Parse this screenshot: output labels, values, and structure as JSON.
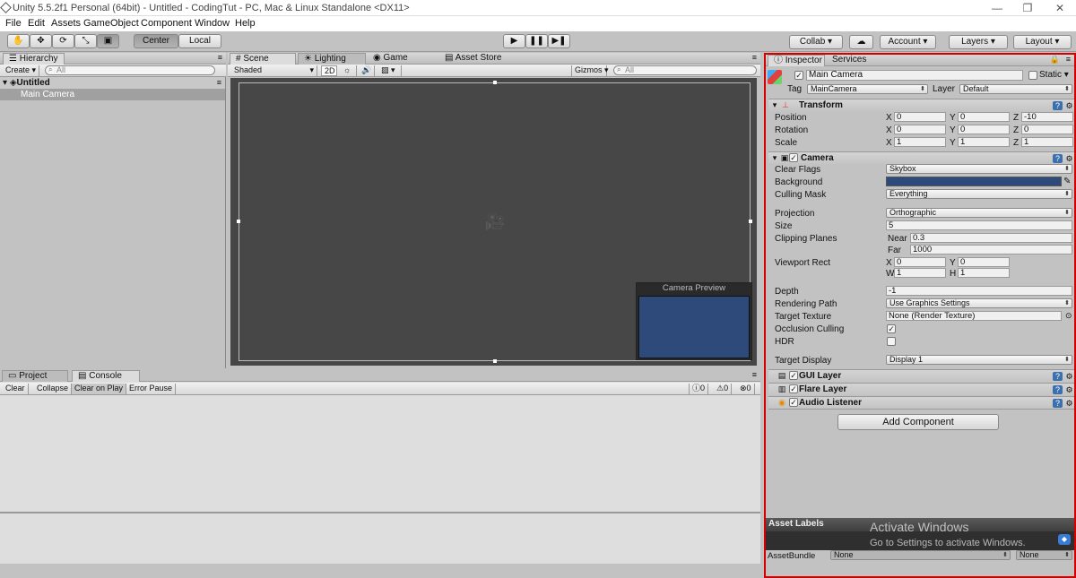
{
  "window": {
    "title": "Unity 5.5.2f1 Personal (64bit) - Untitled - CodingTut - PC, Mac & Linux Standalone <DX11>",
    "min_icon": "minimize-icon",
    "max_icon": "maximize-icon",
    "close_icon": "close-icon"
  },
  "menu": [
    "File",
    "Edit",
    "Assets",
    "GameObject",
    "Component",
    "Window",
    "Help"
  ],
  "toolbar": {
    "tools": [
      "hand-icon",
      "move-icon",
      "rotate-icon",
      "scale-icon",
      "rect-icon"
    ],
    "pivot": "Center",
    "space": "Local",
    "collab": "Collab",
    "cloud_icon": "cloud-icon",
    "account": "Account",
    "layers": "Layers",
    "layout": "Layout"
  },
  "hierarchy": {
    "tab": "Hierarchy",
    "create": "Create",
    "search_placeholder": "All",
    "scene": "Untitled",
    "items": [
      "Main Camera"
    ]
  },
  "scene": {
    "tabs": [
      "Scene",
      "Lighting",
      "Game",
      "Asset Store"
    ],
    "shading": "Shaded",
    "mode2d": "2D",
    "gizmos": "Gizmos",
    "search_placeholder": "All",
    "camera_preview": "Camera Preview",
    "colors": {
      "viewport": "#474747",
      "preview": "#2d4a7a"
    }
  },
  "console": {
    "tabs": [
      "Project",
      "Console"
    ],
    "buttons": [
      "Clear",
      "Collapse",
      "Clear on Play",
      "Error Pause"
    ],
    "counts": [
      "0",
      "0",
      "0"
    ]
  },
  "inspector": {
    "tabs": [
      "Inspector",
      "Services"
    ],
    "object_name": "Main Camera",
    "static_label": "Static",
    "tag_label": "Tag",
    "tag_value": "MainCamera",
    "layer_label": "Layer",
    "layer_value": "Default",
    "transform": {
      "title": "Transform",
      "position": {
        "label": "Position",
        "x": "0",
        "y": "0",
        "z": "-10"
      },
      "rotation": {
        "label": "Rotation",
        "x": "0",
        "y": "0",
        "z": "0"
      },
      "scale": {
        "label": "Scale",
        "x": "1",
        "y": "1",
        "z": "1"
      }
    },
    "camera": {
      "title": "Camera",
      "clear_flags": {
        "label": "Clear Flags",
        "value": "Skybox"
      },
      "background": {
        "label": "Background",
        "color": "#2d4a7a"
      },
      "culling_mask": {
        "label": "Culling Mask",
        "value": "Everything"
      },
      "projection": {
        "label": "Projection",
        "value": "Orthographic"
      },
      "size": {
        "label": "Size",
        "value": "5"
      },
      "clipping": {
        "label": "Clipping Planes",
        "near_label": "Near",
        "near": "0.3",
        "far_label": "Far",
        "far": "1000"
      },
      "viewport": {
        "label": "Viewport Rect",
        "x": "0",
        "y": "0",
        "w": "1",
        "h": "1"
      },
      "depth": {
        "label": "Depth",
        "value": "-1"
      },
      "rendering_path": {
        "label": "Rendering Path",
        "value": "Use Graphics Settings"
      },
      "target_texture": {
        "label": "Target Texture",
        "value": "None (Render Texture)"
      },
      "occlusion": {
        "label": "Occlusion Culling",
        "checked": true
      },
      "hdr": {
        "label": "HDR",
        "checked": false
      },
      "target_display": {
        "label": "Target Display",
        "value": "Display 1"
      }
    },
    "components": [
      "GUI Layer",
      "Flare Layer",
      "Audio Listener"
    ],
    "add_component": "Add Component",
    "asset_labels": "Asset Labels",
    "assetbundle_label": "AssetBundle",
    "assetbundle_value": "None",
    "assetbundle_variant": "None",
    "watermark_line1": "Activate Windows",
    "watermark_line2": "Go to Settings to activate Windows."
  }
}
